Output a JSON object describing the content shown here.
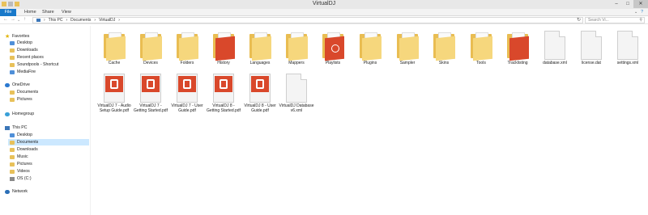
{
  "window": {
    "title": "VirtualDJ"
  },
  "ribbon": {
    "file": "File",
    "home": "Home",
    "share": "Share",
    "view": "View"
  },
  "address": {
    "parts": [
      "This PC",
      "Documents",
      "VirtualDJ"
    ],
    "search_placeholder": "Search Vi..."
  },
  "navpane": {
    "favorites": "Favorites",
    "fav_items": [
      "Desktop",
      "Downloads",
      "Recent places",
      "Soundpools - Shortcut",
      "MediaFire"
    ],
    "onedrive": "OneDrive",
    "onedrive_items": [
      "Documents",
      "Pictures"
    ],
    "homegroup": "Homegroup",
    "thispc": "This PC",
    "pc_items": [
      "Desktop",
      "Documents",
      "Downloads",
      "Music",
      "Pictures",
      "Videos",
      "OS (C:)"
    ],
    "network": "Network"
  },
  "files": [
    {
      "label": "Cache",
      "type": "folder"
    },
    {
      "label": "Devices",
      "type": "folder"
    },
    {
      "label": "Folders",
      "type": "folder"
    },
    {
      "label": "History",
      "type": "folder-red"
    },
    {
      "label": "Languages",
      "type": "folder"
    },
    {
      "label": "Mappers",
      "type": "folder"
    },
    {
      "label": "Playlists",
      "type": "folder-red"
    },
    {
      "label": "Plugins",
      "type": "folder"
    },
    {
      "label": "Sampler",
      "type": "folder"
    },
    {
      "label": "Skins",
      "type": "folder"
    },
    {
      "label": "Tools",
      "type": "folder"
    },
    {
      "label": "Tracklisting",
      "type": "folder-red"
    },
    {
      "label": "database.xml",
      "type": "doc"
    },
    {
      "label": "license.dat",
      "type": "doc"
    },
    {
      "label": "settings.xml",
      "type": "doc"
    },
    {
      "label": "VirtualDJ 7 - Audio Setup Guide.pdf",
      "type": "pdf"
    },
    {
      "label": "VirtualDJ 7 - Getting Started.pdf",
      "type": "pdf"
    },
    {
      "label": "VirtualDJ 7 - User Guide.pdf",
      "type": "pdf"
    },
    {
      "label": "VirtualDJ 8 - Getting Started.pdf",
      "type": "pdf"
    },
    {
      "label": "VirtualDJ 8 - User Guide.pdf",
      "type": "pdf"
    },
    {
      "label": "VirtualDJ Database v6.xml",
      "type": "doc"
    }
  ]
}
